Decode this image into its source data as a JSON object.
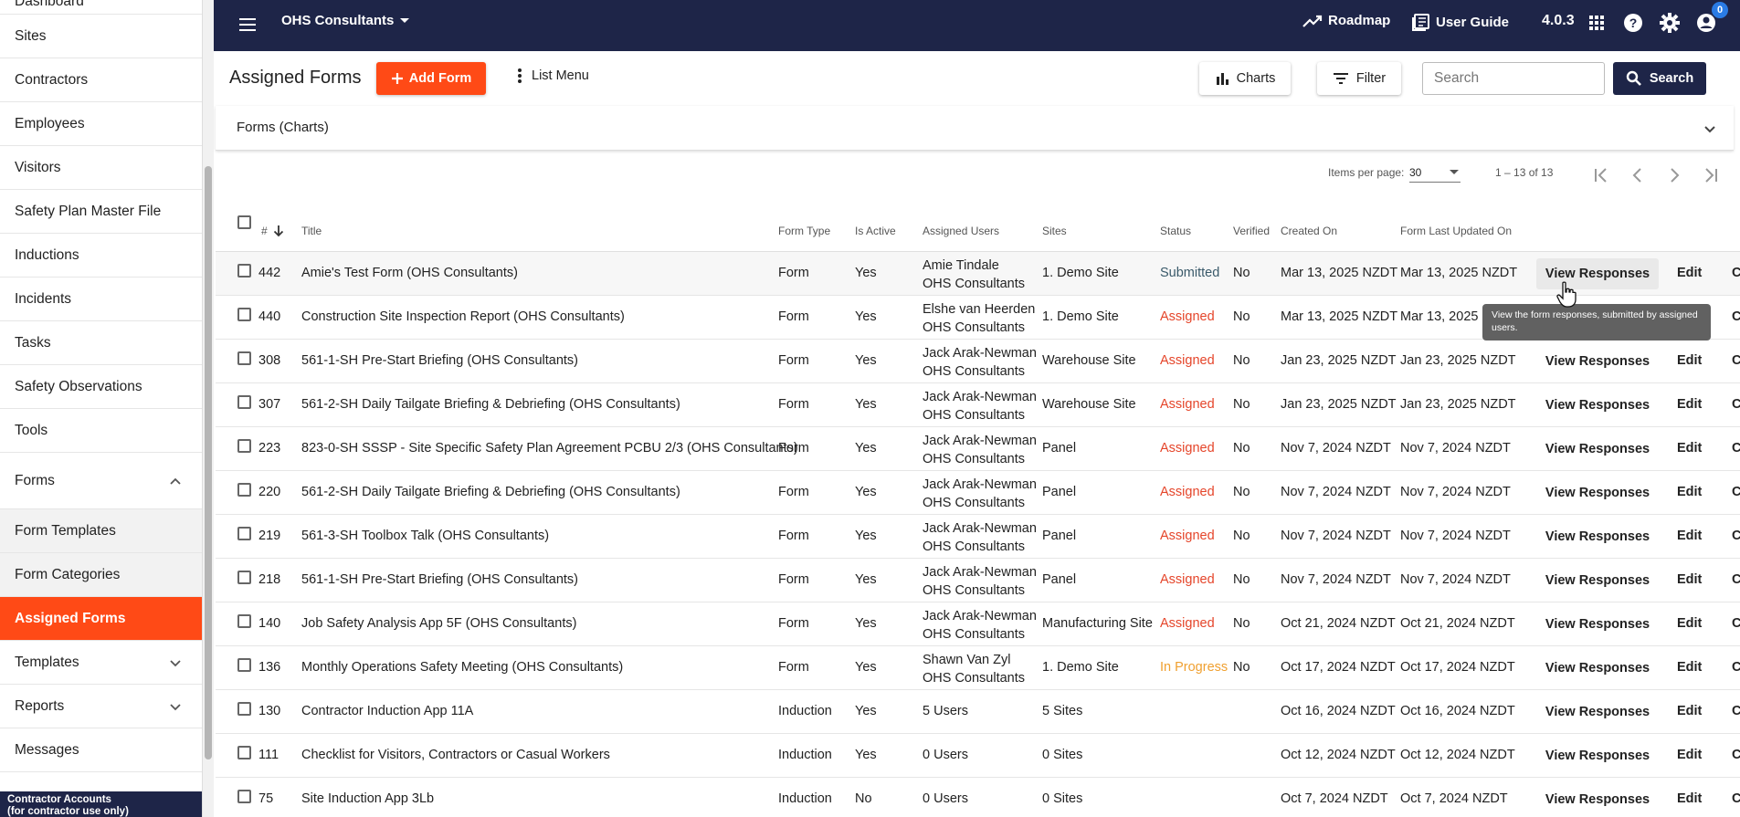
{
  "sidebar": {
    "items": [
      {
        "label": "Dashboard",
        "name": "sidebar-item-dashboard"
      },
      {
        "label": "Sites",
        "name": "sidebar-item-sites"
      },
      {
        "label": "Contractors",
        "name": "sidebar-item-contractors"
      },
      {
        "label": "Employees",
        "name": "sidebar-item-employees"
      },
      {
        "label": "Visitors",
        "name": "sidebar-item-visitors"
      },
      {
        "label": "Safety Plan Master File",
        "name": "sidebar-item-safety-plan-master-file"
      },
      {
        "label": "Inductions",
        "name": "sidebar-item-inductions"
      },
      {
        "label": "Incidents",
        "name": "sidebar-item-incidents"
      },
      {
        "label": "Tasks",
        "name": "sidebar-item-tasks"
      },
      {
        "label": "Safety Observations",
        "name": "sidebar-item-safety-observations"
      },
      {
        "label": "Tools",
        "name": "sidebar-item-tools"
      }
    ],
    "forms_label": "Forms",
    "forms_sub": [
      {
        "label": "Form Templates"
      },
      {
        "label": "Form Categories"
      },
      {
        "label": "Assigned Forms"
      }
    ],
    "templates_label": "Templates",
    "reports_label": "Reports",
    "messages_label": "Messages",
    "footer_line1": "Contractor Accounts",
    "footer_line2": "(for contractor use only)"
  },
  "topbar": {
    "org": "OHS Consultants",
    "roadmap": "Roadmap",
    "user_guide": "User Guide",
    "version": "4.0.3",
    "badge": "0"
  },
  "header": {
    "title": "Assigned Forms",
    "add_form": "Add Form",
    "list_menu": "List Menu",
    "charts": "Charts",
    "filter": "Filter",
    "search_placeholder": "Search",
    "search_button": "Search"
  },
  "charts_panel": {
    "label": "Forms (Charts)"
  },
  "pager": {
    "items_per_page_label": "Items per page:",
    "items_per_page": "30",
    "range": "1 – 13 of 13"
  },
  "table": {
    "headers": {
      "num": "#",
      "title": "Title",
      "form_type": "Form Type",
      "is_active": "Is Active",
      "assigned_users": "Assigned Users",
      "sites": "Sites",
      "status": "Status",
      "verified": "Verified",
      "created_on": "Created On",
      "updated_on": "Form Last Updated On"
    },
    "view_label": "View Responses",
    "edit_label": "Edit",
    "more_label": "C",
    "rows": [
      {
        "id": "442",
        "title": "Amie's Test Form (OHS Consultants)",
        "type": "Form",
        "active": "Yes",
        "user1": "Amie Tindale",
        "user2": "OHS Consultants",
        "site": "1. Demo Site",
        "status": "Submitted",
        "verified": "No",
        "created": "Mar 13, 2025 NZDT",
        "updated": "Mar 13, 2025 NZDT"
      },
      {
        "id": "440",
        "title": "Construction Site Inspection Report (OHS Consultants)",
        "type": "Form",
        "active": "Yes",
        "user1": "Elshe van Heerden",
        "user2": "OHS Consultants",
        "site": "1. Demo Site",
        "status": "Assigned",
        "verified": "No",
        "created": "Mar 13, 2025 NZDT",
        "updated": "Mar 13, 2025 NZDT"
      },
      {
        "id": "308",
        "title": "561-1-SH Pre-Start Briefing (OHS Consultants)",
        "type": "Form",
        "active": "Yes",
        "user1": "Jack Arak-Newman",
        "user2": "OHS Consultants",
        "site": "Warehouse Site",
        "status": "Assigned",
        "verified": "No",
        "created": "Jan 23, 2025 NZDT",
        "updated": "Jan 23, 2025 NZDT"
      },
      {
        "id": "307",
        "title": "561-2-SH Daily Tailgate Briefing & Debriefing (OHS Consultants)",
        "type": "Form",
        "active": "Yes",
        "user1": "Jack Arak-Newman",
        "user2": "OHS Consultants",
        "site": "Warehouse Site",
        "status": "Assigned",
        "verified": "No",
        "created": "Jan 23, 2025 NZDT",
        "updated": "Jan 23, 2025 NZDT"
      },
      {
        "id": "223",
        "title": "823-0-SH SSSP - Site Specific Safety Plan Agreement PCBU 2/3 (OHS Consultants)",
        "type": "Form",
        "active": "Yes",
        "user1": "Jack Arak-Newman",
        "user2": "OHS Consultants",
        "site": "Panel",
        "status": "Assigned",
        "verified": "No",
        "created": "Nov 7, 2024 NZDT",
        "updated": "Nov 7, 2024 NZDT"
      },
      {
        "id": "220",
        "title": "561-2-SH Daily Tailgate Briefing & Debriefing (OHS Consultants)",
        "type": "Form",
        "active": "Yes",
        "user1": "Jack Arak-Newman",
        "user2": "OHS Consultants",
        "site": "Panel",
        "status": "Assigned",
        "verified": "No",
        "created": "Nov 7, 2024 NZDT",
        "updated": "Nov 7, 2024 NZDT"
      },
      {
        "id": "219",
        "title": "561-3-SH Toolbox Talk (OHS Consultants)",
        "type": "Form",
        "active": "Yes",
        "user1": "Jack Arak-Newman",
        "user2": "OHS Consultants",
        "site": "Panel",
        "status": "Assigned",
        "verified": "No",
        "created": "Nov 7, 2024 NZDT",
        "updated": "Nov 7, 2024 NZDT"
      },
      {
        "id": "218",
        "title": "561-1-SH Pre-Start Briefing (OHS Consultants)",
        "type": "Form",
        "active": "Yes",
        "user1": "Jack Arak-Newman",
        "user2": "OHS Consultants",
        "site": "Panel",
        "status": "Assigned",
        "verified": "No",
        "created": "Nov 7, 2024 NZDT",
        "updated": "Nov 7, 2024 NZDT"
      },
      {
        "id": "140",
        "title": "Job Safety Analysis App 5F (OHS Consultants)",
        "type": "Form",
        "active": "Yes",
        "user1": "Jack Arak-Newman",
        "user2": "OHS Consultants",
        "site": "Manufacturing Site",
        "status": "Assigned",
        "verified": "No",
        "created": "Oct 21, 2024 NZDT",
        "updated": "Oct 21, 2024 NZDT"
      },
      {
        "id": "136",
        "title": "Monthly Operations Safety Meeting (OHS Consultants)",
        "type": "Form",
        "active": "Yes",
        "user1": "Shawn Van Zyl",
        "user2": "OHS Consultants",
        "site": "1. Demo Site",
        "status": "In Progress",
        "verified": "No",
        "created": "Oct 17, 2024 NZDT",
        "updated": "Oct 17, 2024 NZDT"
      },
      {
        "id": "130",
        "title": "Contractor Induction App 11A",
        "type": "Induction",
        "active": "Yes",
        "user1": "5 Users",
        "user2": "",
        "site": "5 Sites",
        "status": "",
        "verified": "",
        "created": "Oct 16, 2024 NZDT",
        "updated": "Oct 16, 2024 NZDT"
      },
      {
        "id": "111",
        "title": "Checklist for Visitors, Contractors or Casual Workers",
        "type": "Induction",
        "active": "Yes",
        "user1": "0 Users",
        "user2": "",
        "site": "0 Sites",
        "status": "",
        "verified": "",
        "created": "Oct 12, 2024 NZDT",
        "updated": "Oct 12, 2024 NZDT"
      },
      {
        "id": "75",
        "title": "Site Induction App 3Lb",
        "type": "Induction",
        "active": "No",
        "user1": "0 Users",
        "user2": "",
        "site": "0 Sites",
        "status": "",
        "verified": "",
        "created": "Oct 7, 2024 NZDT",
        "updated": "Oct 7, 2024 NZDT"
      }
    ]
  },
  "tooltip": {
    "text": "View the form responses, submitted by assigned users."
  },
  "colors": {
    "navy": "#1e2548",
    "accent": "#ff4a16",
    "assigned": "#e5452a",
    "in_progress": "#f0a030"
  }
}
